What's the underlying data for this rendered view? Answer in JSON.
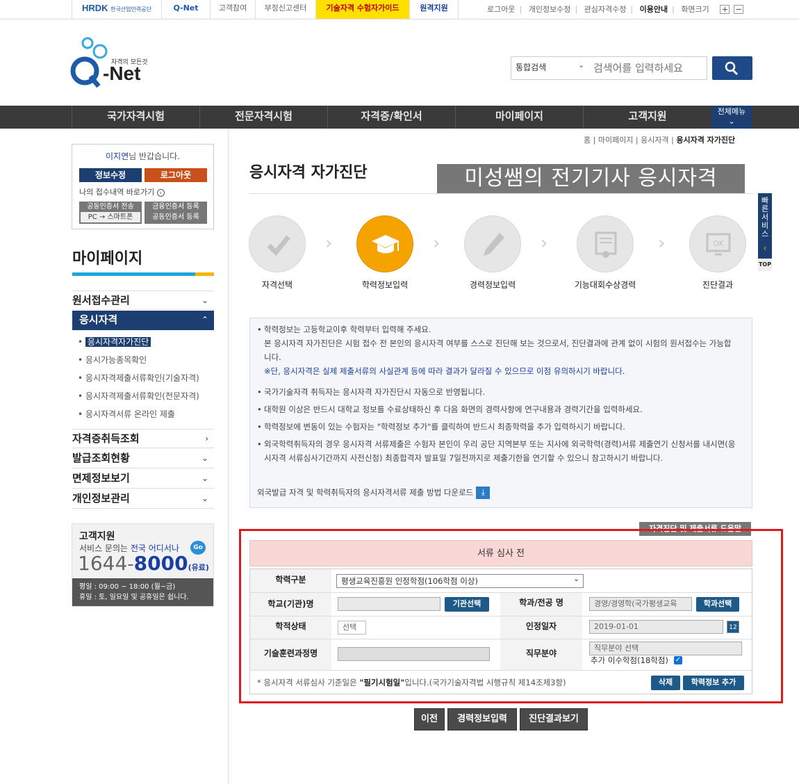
{
  "topbar": {
    "hrdk": "HRDK",
    "hrdk_sub": "한국산업인력공단",
    "qnet_small": "Q-Net",
    "links": [
      "고객참여",
      "부정신고센터",
      "기술자격 수험자가이드",
      "원격지원"
    ],
    "util": [
      "로그아웃",
      "개인정보수정",
      "관심자격수정",
      "이용안내",
      "화면크기"
    ],
    "zoom_in": "+",
    "zoom_out": "−"
  },
  "header": {
    "logo_tagline": "자격의 모든것",
    "logo_name": "-Net",
    "logo_q": "Q",
    "search_scope": "통합검색",
    "search_placeholder": "검색어를 입력하세요"
  },
  "gnb": {
    "items": [
      "국가자격시험",
      "전문자격시험",
      "자격증/확인서",
      "마이페이지",
      "고객지원"
    ],
    "all_menu": "전체메뉴"
  },
  "login": {
    "user": "이지연",
    "greeting": "님 반갑습니다.",
    "edit": "정보수정",
    "logout": "로그아웃",
    "history": "나의 접수내역 바로가기",
    "cert1a": "공동인증서 전송",
    "cert1b": "PC → 스마트폰",
    "cert2a": "금융인증서 등록",
    "cert2b": "공동인증서 등록"
  },
  "sidebar": {
    "title": "마이페이지",
    "menus": [
      {
        "label": "원서접수관리",
        "chev": "⌄"
      },
      {
        "label": "응시자격",
        "chev": "⌃"
      },
      {
        "label": "자격증취득조회",
        "chev": "›"
      },
      {
        "label": "발급조회현황",
        "chev": "⌄"
      },
      {
        "label": "면제정보보기",
        "chev": "⌄"
      },
      {
        "label": "개인정보관리",
        "chev": "⌄"
      }
    ],
    "subs": [
      "응시자격자가진단",
      "응시가능종목확인",
      "응시자격제출서류확인(기술자격)",
      "응시자격제출서류확인(전문자격)",
      "응시자격서류 온라인 제출"
    ]
  },
  "cs": {
    "title": "고객지원",
    "line_a": "서비스 문의는 ",
    "line_b": "전국 어디서나",
    "go": "Go",
    "phone_a": "1644",
    "phone_dash": "-",
    "phone_b": "8000",
    "paid": "(유료)",
    "hours1": "평일 : 09:00 ~ 18:00 (월~금)",
    "hours2": "휴일 : 토, 일요일 및 공휴일은 쉽니다."
  },
  "breadcrumb": [
    "홈",
    "마이페이지",
    "응시자격",
    "응시자격 자가진단"
  ],
  "page": {
    "title": "응시자격 자가진단",
    "overlay": "미성쌤의 전기기사 응시자격"
  },
  "steps": [
    "자격선택",
    "학력정보입력",
    "경력정보입력",
    "기능대회수상경력",
    "진단결과"
  ],
  "step_current": 2,
  "quick": {
    "label": "빠른서비스",
    "top": "TOP"
  },
  "notice": {
    "items": [
      "학력정보는 고등학교이후 학력부터 입력해 주세요.",
      "본 응시자격 자가진단은 시험 접수 전 본인의 응시자격 여부를 스스로 진단해 보는 것으로서, 진단결과에 관계 없이 시험의 원서접수는 가능합니다.",
      "※단, 응시자격은 실제 제출서류의 사실관계 등에 따라 결과가 달라질 수 있으므로 이점 유의하시기 바랍니다.",
      "국가기술자격 취득자는 응시자격 자가진단시 자동으로 반영됩니다.",
      "대학원 이상은 반드시 대학교 정보를 수료상태하신 후 다음 화면의 경력사항에 연구내용과 경력기간을 입력하세요.",
      "학력정보에 변동이 있는 수험자는 \"학력정보 추가\"를 클릭하여 반드시 최종학력을 추가 입력하시기 바랍니다.",
      "외국학력취득자의 경우 응시자격 서류제출은 수험자 본인이 우리 공단 지역본부 또는 지사에 외국학력(경력)서류 제출연기 신청서를 내시면(응시자격 서류심사기간까지 사전신청) 최종합격자 발표일 7일전까지로 제출기한을 연기할 수 있으니 참고하시기 바랍니다."
    ],
    "download": "외국발급 자격 및 학력취득자의 응시자격서류 제출 방법 다운로드"
  },
  "form": {
    "tab_hidden": "자격진단 및 제출서류 도움말",
    "status": "서류 심사 전",
    "edu_type_label": "학력구분",
    "edu_type_value": "평생교육진흥원 인정학점(106학점 이상)",
    "school_label": "학교(기관)명",
    "school_value": "",
    "school_btn": "기관선택",
    "major_label": "학과/전공 명",
    "major_value": "경영/경영학(국가평생교육",
    "major_btn": "학과선택",
    "status_label": "학적상태",
    "status_value": "선택",
    "date_label": "인정일자",
    "date_value": "2019-01-01",
    "cal": "12",
    "training_label": "기술훈련과정명",
    "training_value": "",
    "job_label": "직무분야",
    "job_value": "직무분야 선택",
    "credit_label": "추가 이수학점(18학점)",
    "note_a": "* 응시자격 서류심사 기준일은 ",
    "note_b": "\"필기시험일\"",
    "note_c": "입니다.(국가기술자격법 시행규칙 제14조제3항)",
    "delete_btn": "삭제",
    "add_btn": "학력정보 추가"
  },
  "bottom": {
    "prev": "이전",
    "career": "경력정보입력",
    "result": "진단결과보기"
  },
  "colors": {
    "navy": "#1d3e70",
    "orange": "#f5a300",
    "red_box": "#e0191e",
    "guide_yellow": "#ffe000"
  }
}
